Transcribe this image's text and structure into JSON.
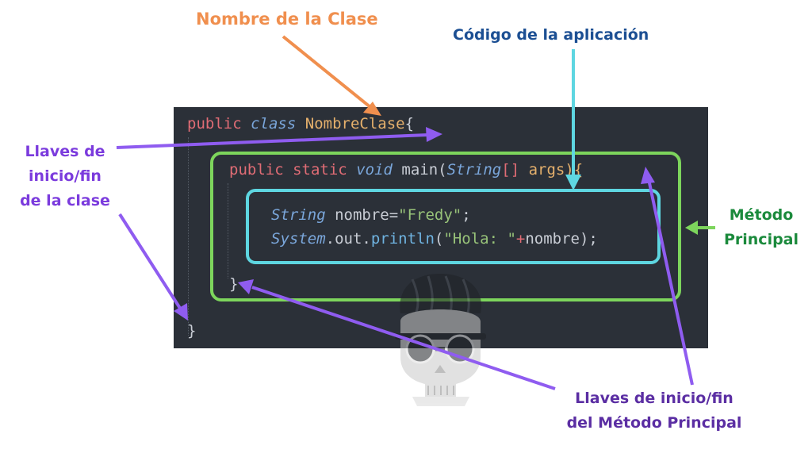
{
  "labels": {
    "class_name": "Nombre de la Clase",
    "app_code": "Código de la aplicación",
    "class_braces_lines": [
      "Llaves de",
      "inicio/fin",
      "de la clase"
    ],
    "main_method_lines": [
      "Método",
      "Principal"
    ],
    "method_braces_lines": [
      "Llaves de inicio/fin",
      "del Método Principal"
    ]
  },
  "code": {
    "line1": {
      "kw_public": "public",
      "kw_class": "class",
      "class_name": "NombreClase",
      "open_brace": "{"
    },
    "line2": {
      "kw_public": "public",
      "kw_static": "static",
      "kw_void": "void",
      "method_name": "main(",
      "type_string": "String",
      "array_brackets": "[]",
      "param": " args){"
    },
    "line3": {
      "type_string": "String",
      "assign": " nombre=",
      "value": "\"Fredy\"",
      "end": ";"
    },
    "line4": {
      "system": "System",
      "dot_out": ".out.",
      "println": "println",
      "open_paren": "(",
      "value": "\"Hola: \"",
      "plus": "+",
      "rest": "nombre);"
    },
    "line5": {
      "close_brace": "}"
    },
    "line6": {
      "close_brace": "}"
    }
  },
  "colors": {
    "panel_bg": "#2b3038",
    "method_box": "#7dd55c",
    "code_box": "#5ed6e1",
    "arrow_orange": "#f08f4e",
    "arrow_cyan": "#5ed6e1",
    "arrow_purple": "#8f5cf0",
    "arrow_green": "#7dd55c"
  },
  "icons": {
    "watermark": "skull-with-glasses-icon"
  }
}
